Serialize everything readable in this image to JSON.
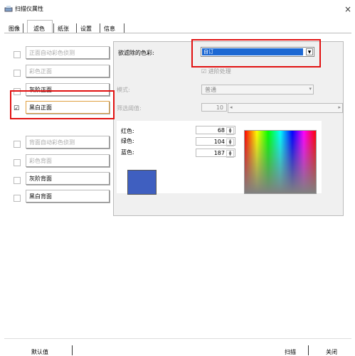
{
  "window": {
    "title": "扫描仪属性",
    "close_label": "×"
  },
  "tabs": [
    "图像",
    "滤色",
    "纸张",
    "设置",
    "信息"
  ],
  "active_tab": "滤色",
  "side_items": [
    {
      "label": "正面自动彩色侦测",
      "checked": false,
      "enabled": false
    },
    {
      "label": "彩色正面",
      "checked": false,
      "enabled": false
    },
    {
      "label": "灰阶正面",
      "checked": false,
      "enabled": true
    },
    {
      "label": "黑白正面",
      "checked": true,
      "enabled": true,
      "highlighted": true
    },
    {
      "label": "背面自动彩色侦测",
      "checked": false,
      "enabled": false
    },
    {
      "label": "彩色背面",
      "checked": false,
      "enabled": false
    },
    {
      "label": "灰阶背面",
      "checked": false,
      "enabled": true
    },
    {
      "label": "黑白背面",
      "checked": false,
      "enabled": true
    }
  ],
  "check_mark": "☑",
  "filter": {
    "color_label": "欲滤除的色彩:",
    "color_value": "自订",
    "advanced_label": "进阶处理",
    "mode_label": "模式:",
    "mode_value": "普通",
    "threshold_label": "筛选阈值:",
    "threshold_value": "10"
  },
  "rgb": {
    "red_label": "红色:",
    "red_value": "68",
    "green_label": "绿色:",
    "green_value": "104",
    "blue_label": "蓝色:",
    "blue_value": "187"
  },
  "swatch_color": "#3f5fc0",
  "highlight_color": "#e11111",
  "footer": {
    "default_label": "默认值",
    "scan_label": "扫描",
    "close_label": "关闭"
  }
}
